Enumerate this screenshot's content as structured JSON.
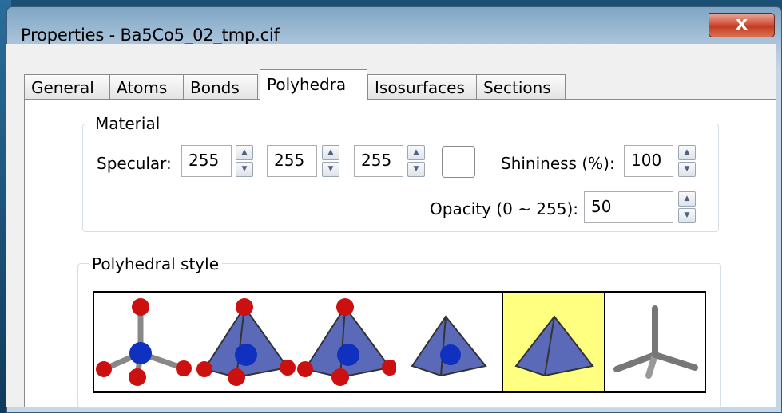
{
  "window": {
    "title": "Properties - Ba5Co5_02_tmp.cif",
    "close_glyph": "x"
  },
  "tabs": [
    {
      "label": "General",
      "active": false
    },
    {
      "label": "Atoms",
      "active": false
    },
    {
      "label": "Bonds",
      "active": false
    },
    {
      "label": "Polyhedra",
      "active": true
    },
    {
      "label": "Isosurfaces",
      "active": false
    },
    {
      "label": "Sections",
      "active": false
    }
  ],
  "material": {
    "group_label": "Material",
    "specular_label": "Specular:",
    "specular_r": "255",
    "specular_g": "255",
    "specular_b": "255",
    "shininess_label": "Shininess (%):",
    "shininess_value": "100",
    "opacity_label": "Opacity (0 ~ 255):",
    "opacity_value": "50"
  },
  "polyhedral_style": {
    "group_label": "Polyhedral style",
    "options": [
      "ball-and-stick-icon",
      "polyhedron-with-atoms-bonds-icon",
      "polyhedron-with-atoms-icon",
      "polyhedron-with-center-icon",
      "polyhedron-only-icon",
      "wireframe-stick-icon"
    ],
    "selected_index": 4,
    "selected_color": "#ffff80"
  },
  "colors": {
    "atom_red": "#cc1010",
    "atom_blue": "#1030c0",
    "polyhedron": "#5a6ab8",
    "bond_grey": "#888888"
  }
}
